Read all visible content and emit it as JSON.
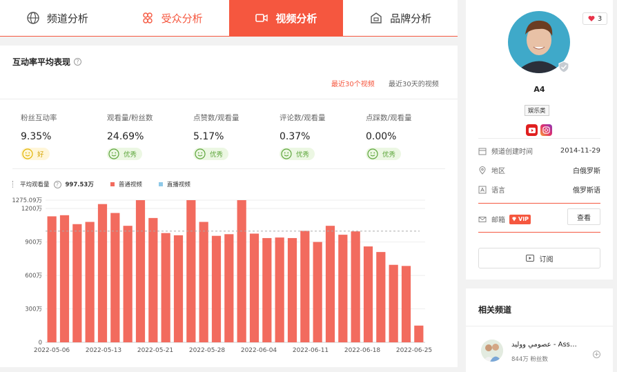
{
  "tabs": [
    {
      "label": "频道分析",
      "icon": "globe-icon"
    },
    {
      "label": "受众分析",
      "icon": "audience-icon"
    },
    {
      "label": "视频分析",
      "icon": "video-icon"
    },
    {
      "label": "品牌分析",
      "icon": "brand-icon"
    }
  ],
  "section": {
    "title": "互动率平均表现",
    "help": "?",
    "filters": [
      "最近30个视频",
      "最近30天的视频"
    ]
  },
  "metrics": [
    {
      "label": "粉丝互动率",
      "value": "9.35%",
      "badge": "好",
      "level": "ok"
    },
    {
      "label": "观看量/粉丝数",
      "value": "24.69%",
      "badge": "优秀",
      "level": "great"
    },
    {
      "label": "点赞数/观看量",
      "value": "5.17%",
      "badge": "优秀",
      "level": "great"
    },
    {
      "label": "评论数/观看量",
      "value": "0.37%",
      "badge": "优秀",
      "level": "great"
    },
    {
      "label": "点踩数/观看量",
      "value": "0.00%",
      "badge": "优秀",
      "level": "great"
    }
  ],
  "legend": {
    "avg_label": "平均观看量",
    "avg_value": "997.53万",
    "series": [
      {
        "name": "普通视频",
        "color": "#f26b5e"
      },
      {
        "name": "直播视频",
        "color": "#8ec9e8"
      }
    ]
  },
  "chart_data": {
    "type": "bar",
    "title": "",
    "xlabel": "",
    "ylabel": "",
    "ylim": [
      0,
      1275.09
    ],
    "y_ticks": [
      0,
      300,
      600,
      900,
      1200,
      1275.09
    ],
    "y_tick_labels": [
      "0",
      "300万",
      "600万",
      "900万",
      "1200万",
      "1275.09万"
    ],
    "x_tick_labels": [
      "2022-05-06",
      "2022-05-13",
      "2022-05-21",
      "2022-05-28",
      "2022-06-04",
      "2022-06-11",
      "2022-06-18",
      "2022-06-25"
    ],
    "average": 997.53,
    "series": [
      {
        "name": "普通视频",
        "values": [
          1130,
          1140,
          1060,
          1080,
          1240,
          1160,
          1045,
          1275,
          1115,
          980,
          960,
          1275,
          1080,
          955,
          970,
          1275,
          975,
          935,
          940,
          935,
          1000,
          900,
          1045,
          965,
          995,
          860,
          810,
          695,
          685,
          150
        ]
      }
    ]
  },
  "profile": {
    "likes": "3",
    "name": "A4",
    "category": "娱乐类",
    "created_label": "频道创建时间",
    "created_value": "2014-11-29",
    "region_label": "地区",
    "region_value": "白俄罗斯",
    "language_label": "语言",
    "language_value": "俄罗斯语",
    "email_label": "邮箱",
    "vip": "VIP",
    "view_button": "查看",
    "subscribe_button": "订阅"
  },
  "related": {
    "title": "相关频道",
    "items": [
      {
        "name": "عصومي ووليد - Ass…",
        "subs": "844万 粉丝数"
      }
    ]
  },
  "colors": {
    "accent": "#f5573f",
    "bar": "#f26b5e"
  }
}
